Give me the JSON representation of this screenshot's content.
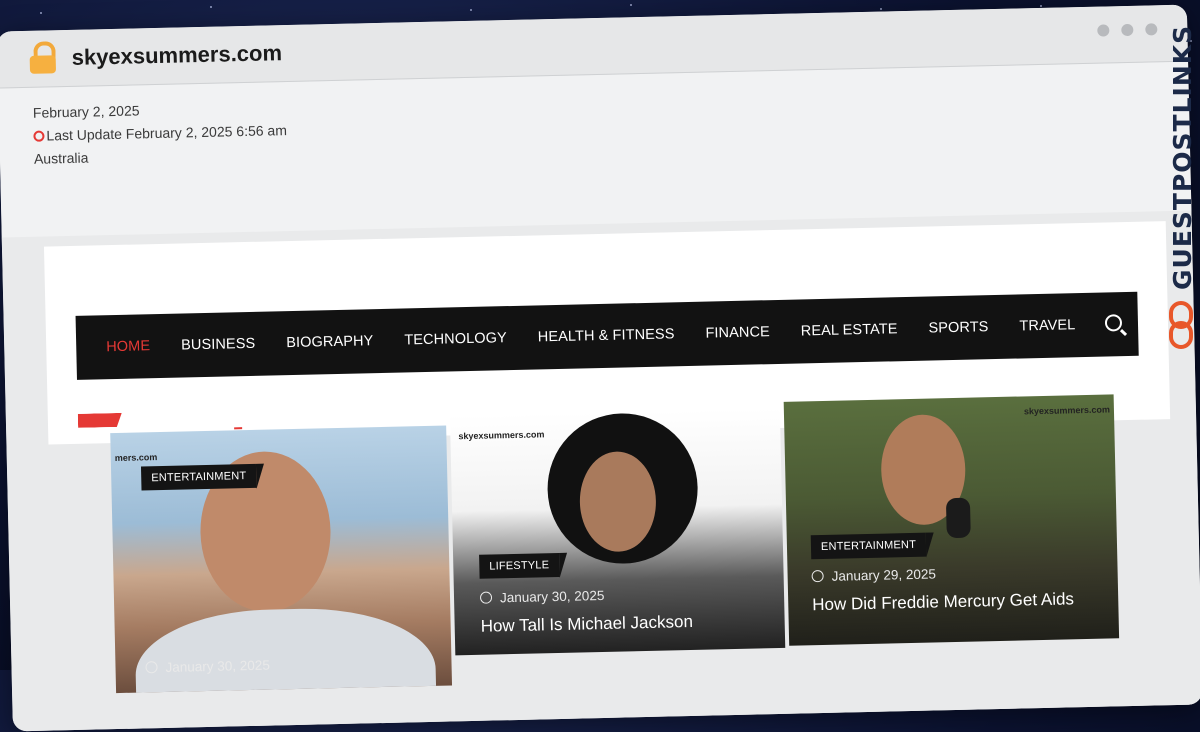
{
  "browser": {
    "domain": "skyexsummers.com"
  },
  "topinfo": {
    "date": "February 2, 2025",
    "last_update": "Last Update February 2, 2025 6:56 am",
    "location": "Australia"
  },
  "nav": {
    "items": [
      "HOME",
      "BUSINESS",
      "BIOGRAPHY",
      "TECHNOLOGY",
      "HEALTH & FITNESS",
      "FINANCE",
      "REAL ESTATE",
      "SPORTS",
      "TRAVEL"
    ],
    "active": "HOME"
  },
  "cards": [
    {
      "category": "ENTERTAINMENT",
      "date": "January 30, 2025",
      "title": "",
      "watermark": "mers.com"
    },
    {
      "category": "LIFESTYLE",
      "date": "January 30, 2025",
      "title": "How Tall Is Michael Jackson",
      "watermark": "skyexsummers.com"
    },
    {
      "category": "ENTERTAINMENT",
      "date": "January 29, 2025",
      "title": "How Did Freddie Mercury Get Aids",
      "watermark": "skyexsummers.com"
    }
  ],
  "badge": {
    "text": "GUESTPOSTLINKS"
  },
  "colors": {
    "accent": "#e53935",
    "navbar": "#121212",
    "badge_text": "#1c2a48",
    "badge_icon": "#e8572a"
  }
}
